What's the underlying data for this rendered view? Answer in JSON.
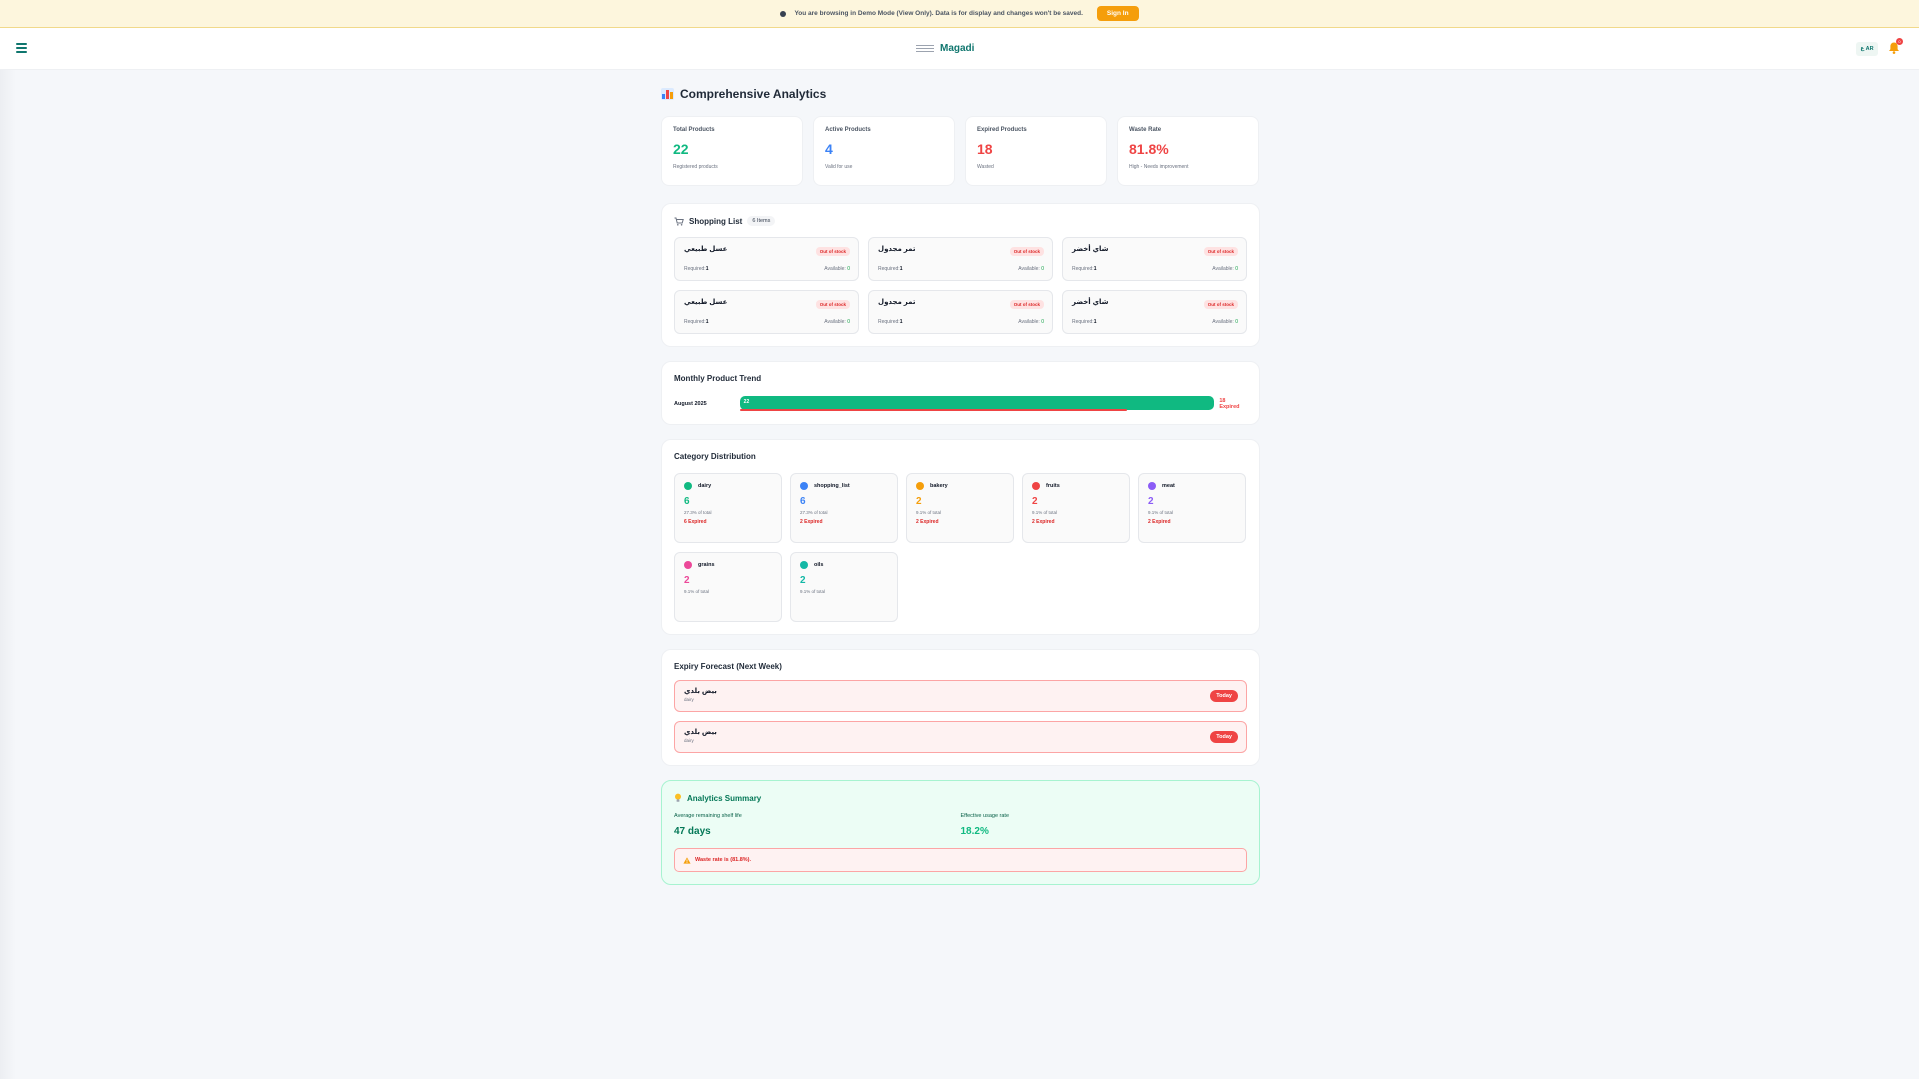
{
  "banner": {
    "text": "You are browsing in Demo Mode (View Only). Data is for display and changes won't be saved.",
    "signin_label": "Sign In"
  },
  "header": {
    "brand": "Magadi",
    "lang_label": "ع AR",
    "notification_count": "0"
  },
  "page": {
    "title": "Comprehensive Analytics"
  },
  "stats": [
    {
      "label": "Total Products",
      "value": "22",
      "sub": "Registered products",
      "color": "#10b981"
    },
    {
      "label": "Active Products",
      "value": "4",
      "sub": "Valid for use",
      "color": "#3b82f6"
    },
    {
      "label": "Expired Products",
      "value": "18",
      "sub": "Wasted",
      "color": "#ef4444"
    },
    {
      "label": "Waste Rate",
      "value": "81.8%",
      "sub": "High - Needs improvement",
      "color": "#ef4444"
    }
  ],
  "shopping": {
    "title": "Shopping List",
    "count": "6 Items",
    "items": [
      {
        "name": "عسل طبيعي",
        "status": "Out of stock",
        "required_label": "Required:",
        "required": "1",
        "available_label": "Available:",
        "available": "0"
      },
      {
        "name": "تمر مجدول",
        "status": "Out of stock",
        "required_label": "Required:",
        "required": "1",
        "available_label": "Available:",
        "available": "0"
      },
      {
        "name": "شاي أخضر",
        "status": "Out of stock",
        "required_label": "Required:",
        "required": "1",
        "available_label": "Available:",
        "available": "0"
      },
      {
        "name": "عسل طبيعي",
        "status": "Out of stock",
        "required_label": "Required:",
        "required": "1",
        "available_label": "Available:",
        "available": "0"
      },
      {
        "name": "تمر مجدول",
        "status": "Out of stock",
        "required_label": "Required:",
        "required": "1",
        "available_label": "Available:",
        "available": "0"
      },
      {
        "name": "شاي أخضر",
        "status": "Out of stock",
        "required_label": "Required:",
        "required": "1",
        "available_label": "Available:",
        "available": "0"
      }
    ]
  },
  "trend": {
    "title": "Monthly Product Trend",
    "month": "August 2025",
    "total": "22",
    "expired_label": "18 Expired",
    "total_fraction": 1.0,
    "expired_fraction": 0.818
  },
  "categories": {
    "title": "Category Distribution",
    "items": [
      {
        "name": "dairy",
        "count": "6",
        "pct": "27.3% of total",
        "expired": "6 Expired",
        "color": "#10b981"
      },
      {
        "name": "shopping_list",
        "count": "6",
        "pct": "27.3% of total",
        "expired": "2 Expired",
        "color": "#3b82f6"
      },
      {
        "name": "bakery",
        "count": "2",
        "pct": "9.1% of total",
        "expired": "2 Expired",
        "color": "#f59e0b"
      },
      {
        "name": "fruits",
        "count": "2",
        "pct": "9.1% of total",
        "expired": "2 Expired",
        "color": "#ef4444"
      },
      {
        "name": "meat",
        "count": "2",
        "pct": "9.1% of total",
        "expired": "2 Expired",
        "color": "#8b5cf6"
      },
      {
        "name": "grains",
        "count": "2",
        "pct": "9.1% of total",
        "expired": "",
        "color": "#ec4899"
      },
      {
        "name": "oils",
        "count": "2",
        "pct": "9.1% of total",
        "expired": "",
        "color": "#14b8a6"
      }
    ]
  },
  "forecast": {
    "title": "Expiry Forecast (Next Week)",
    "items": [
      {
        "name": "بيض بلدي",
        "category": "dairy",
        "badge": "Today"
      },
      {
        "name": "بيض بلدي",
        "category": "dairy",
        "badge": "Today"
      }
    ]
  },
  "summary": {
    "title": "Analytics Summary",
    "shelf_label": "Average remaining shelf life",
    "shelf_value": "47 days",
    "usage_label": "Effective usage rate",
    "usage_value": "18.2%",
    "warning": "Waste rate is (81.8%)."
  },
  "colors": {
    "accent": "#0f766e",
    "positive": "#10b981",
    "danger": "#ef4444",
    "warning": "#f59e0b"
  },
  "icons": {
    "menu": "hamburger-icon",
    "bell": "bell-icon",
    "title": "bar-chart-icon",
    "shopping": "cart-icon",
    "summary": "lightbulb-icon",
    "warning": "warning-triangle-icon"
  }
}
